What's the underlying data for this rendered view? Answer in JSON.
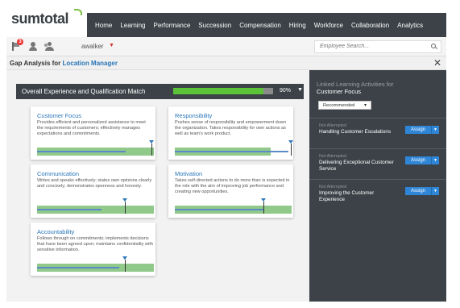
{
  "brand": {
    "logo_text": "sumtotal",
    "accent": "#7bc043"
  },
  "nav": {
    "items": [
      "Home",
      "Learning",
      "Performance",
      "Succession",
      "Compensation",
      "Hiring",
      "Workforce",
      "Collaboration",
      "Analytics"
    ],
    "background": "#3c4248"
  },
  "userbar": {
    "notification_count": "3",
    "username": "awalker",
    "search_placeholder": "Employee Search..."
  },
  "title": {
    "prefix": "Gap Analysis for ",
    "role": "Location Manager"
  },
  "overall": {
    "label": "Overall Experience and Qualification Match",
    "percent_text": "90%",
    "percent_value": 0.9,
    "bar_color": "#5cc238"
  },
  "competencies": [
    {
      "title": "Customer Focus",
      "description": "Provides efficient and personalized assistance to meet the requirements of customers; effectively manages expectations and commitments.",
      "fill": 1.0,
      "current": 0.76,
      "target": 0.98
    },
    {
      "title": "Responsibility",
      "description": "Pushes sense of responsibility and empowerment down the organization. Takes responsibility for own actions as well as team's work product.",
      "fill": 0.82,
      "current": 0.97,
      "target": 0.99
    },
    {
      "title": "Communication",
      "description": "Writes and speaks effectively; states own opinions clearly and concisely; demonstrates openness and honesty.",
      "fill": 1.0,
      "current": 0.55,
      "target": 0.75
    },
    {
      "title": "Motivation",
      "description": "Takes self-directed actions to do more than is expected in the role with the aim of improving job performance and creating new opportunities.",
      "fill": 1.0,
      "current": 0.76,
      "target": 0.76
    },
    {
      "title": "Accountability",
      "description": "Follows through on commitments; implements decisions that have been agreed upon; maintains confidentiality with sensitive information.",
      "fill": 1.0,
      "current": 0.7,
      "target": 0.75
    }
  ],
  "panel": {
    "heading": "Linked Learning Activities for",
    "competency": "Customer Focus",
    "filter_value": "Recommended",
    "activities": [
      {
        "status": "Not Attempted",
        "name": "Handling Customer Escalations",
        "action": "Assign"
      },
      {
        "status": "Not Attempted",
        "name": "Delivering Exceptional Customer Service",
        "action": "Assign"
      },
      {
        "status": "Not Attempted",
        "name": "Improving the Customer Experience",
        "action": "Assign"
      }
    ]
  }
}
